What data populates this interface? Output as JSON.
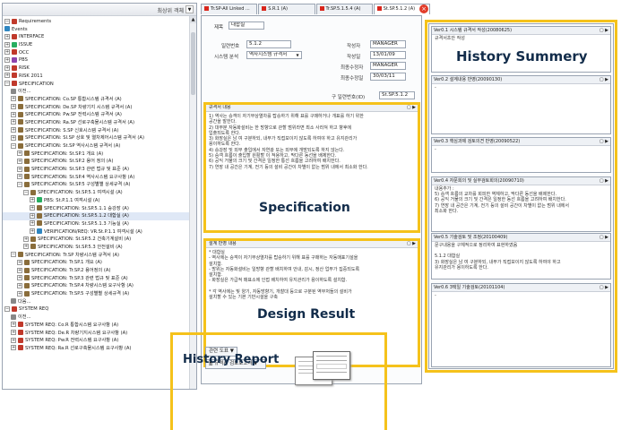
{
  "tree": {
    "sort_label": "최상위 객체",
    "rows": [
      {
        "text": "Requirements",
        "color": "#c0392b",
        "indent": 0,
        "pm": "⊟"
      },
      {
        "text": "Events",
        "color": "#2e86c1",
        "indent": 0,
        "pm": ""
      },
      {
        "text": "INTERFACE",
        "color": "#c0392b",
        "indent": 0,
        "pm": "⊞"
      },
      {
        "text": "ISSUE",
        "color": "#27ae60",
        "indent": 0,
        "pm": "⊞"
      },
      {
        "text": "OCC",
        "color": "#c0392b",
        "indent": 0,
        "pm": "⊞"
      },
      {
        "text": "PBS",
        "color": "#8e44ad",
        "indent": 0,
        "pm": "⊞"
      },
      {
        "text": "RISK",
        "color": "#c0392b",
        "indent": 0,
        "pm": "⊞"
      },
      {
        "text": "RISK 2011",
        "color": "#c0392b",
        "indent": 0,
        "pm": "⊞"
      },
      {
        "text": "SPECIFICATION",
        "color": "#c0392b",
        "indent": 0,
        "pm": "⊟"
      },
      {
        "text": "이전...",
        "color": "#888888",
        "indent": 1,
        "pm": ""
      },
      {
        "text": "SPECIFICATION: Co.SP 통합시스템 규격서 (A)",
        "color": "#8a6d3b",
        "indent": 1,
        "pm": "⊞"
      },
      {
        "text": "SPECIFICATION: De.SP 차량기지 시스템 규격서 (A)",
        "color": "#8a6d3b",
        "indent": 1,
        "pm": "⊞"
      },
      {
        "text": "SPECIFICATION: Pw.SP 전력시스템 규격서 (A)",
        "color": "#8a6d3b",
        "indent": 1,
        "pm": "⊞"
      },
      {
        "text": "SPECIFICATION: Ra.SP 선로구축물시스템 규격서 (A)",
        "color": "#8a6d3b",
        "indent": 1,
        "pm": "⊞"
      },
      {
        "text": "SPECIFICATION: S.SP 신호시스템 규격서 (A)",
        "color": "#8a6d3b",
        "indent": 1,
        "pm": "⊞"
      },
      {
        "text": "SPECIFICATION: SI.SP 상호 및 열차제어시스템 규격서 (A)",
        "color": "#8a6d3b",
        "indent": 1,
        "pm": "⊞"
      },
      {
        "text": "SPECIFICATION: St.SP 역사시스템 규격서 (A)",
        "color": "#8a6d3b",
        "indent": 1,
        "pm": "⊟"
      },
      {
        "text": "SPECIFICATION: St.SP.1 개요 (A)",
        "color": "#8a6d3b",
        "indent": 2,
        "pm": "⊞"
      },
      {
        "text": "SPECIFICATION: St.SP.2 용어 정의 (A)",
        "color": "#8a6d3b",
        "indent": 2,
        "pm": "⊞"
      },
      {
        "text": "SPECIFICATION: St.SP.3 관련 법규 및 표준 (A)",
        "color": "#8a6d3b",
        "indent": 2,
        "pm": "⊞"
      },
      {
        "text": "SPECIFICATION: St.SP.4 역사시스템 요구사항 (A)",
        "color": "#8a6d3b",
        "indent": 2,
        "pm": "⊞"
      },
      {
        "text": "SPECIFICATION: St.SP.5 구성별별 상세규격 (A)",
        "color": "#8a6d3b",
        "indent": 2,
        "pm": "⊟"
      },
      {
        "text": "SPECIFICATION: St.SP.5.1 여객시설 (A)",
        "color": "#8a6d3b",
        "indent": 3,
        "pm": "⊟"
      },
      {
        "text": "PBS: St.P.1.1 여객시설 (A)",
        "color": "#27ae60",
        "indent": 4,
        "pm": "⊞"
      },
      {
        "text": "SPECIFICATION: St.SP.5.1.1 승강장 (A)",
        "color": "#8a6d3b",
        "indent": 4,
        "pm": "⊞"
      },
      {
        "text": "SPECIFICATION: St.SP.5.1.2 대합실 (A)",
        "color": "#8a6d3b",
        "indent": 4,
        "pm": "⊞",
        "selected": true
      },
      {
        "text": "SPECIFICATION: St.SP.5.1.3 기능실 (A)",
        "color": "#8a6d3b",
        "indent": 4,
        "pm": "⊞"
      },
      {
        "text": "VERIFICATION/REQ: VR.St.P.1.1 여객시설 (A)",
        "color": "#2e86c1",
        "indent": 4,
        "pm": "⊞"
      },
      {
        "text": "SPECIFICATION: St.SP.5.2 건축기계설비 (A)",
        "color": "#8a6d3b",
        "indent": 3,
        "pm": "⊞"
      },
      {
        "text": "SPECIFICATION: St.SP.5.3 안전설비 (A)",
        "color": "#8a6d3b",
        "indent": 3,
        "pm": "⊞"
      },
      {
        "text": "SPECIFICATION: Tr.SP 차량시스템 규격서 (A)",
        "color": "#8a6d3b",
        "indent": 1,
        "pm": "⊟"
      },
      {
        "text": "SPECIFICATION: Tr.SP.1 개요 (A)",
        "color": "#8a6d3b",
        "indent": 2,
        "pm": "⊞"
      },
      {
        "text": "SPECIFICATION: Tr.SP.2 용어정의 (A)",
        "color": "#8a6d3b",
        "indent": 2,
        "pm": "⊞"
      },
      {
        "text": "SPECIFICATION: Tr.SP.3 관련 법규 및 표준 (A)",
        "color": "#8a6d3b",
        "indent": 2,
        "pm": "⊞"
      },
      {
        "text": "SPECIFICATION: Tr.SP.4 차량시스템 요구사항 (A)",
        "color": "#8a6d3b",
        "indent": 2,
        "pm": "⊞"
      },
      {
        "text": "SPECIFICATION: Tr.SP.5 구성별별 상세규격 (A)",
        "color": "#8a6d3b",
        "indent": 2,
        "pm": "⊞"
      },
      {
        "text": "다음...",
        "color": "#888888",
        "indent": 1,
        "pm": ""
      },
      {
        "text": "SYSTEM REQ",
        "color": "#c0392b",
        "indent": 0,
        "pm": "⊟"
      },
      {
        "text": "이전...",
        "color": "#888888",
        "indent": 1,
        "pm": ""
      },
      {
        "text": "SYSTEM REQ: Co.R 통합시스템 요구사항 (A)",
        "color": "#c0392b",
        "indent": 1,
        "pm": "⊞"
      },
      {
        "text": "SYSTEM REQ: De.R 차량기지시스템 요구사항 (A)",
        "color": "#c0392b",
        "indent": 1,
        "pm": "⊞"
      },
      {
        "text": "SYSTEM REQ: Pw.R 전력시스템 요구사항 (A)",
        "color": "#c0392b",
        "indent": 1,
        "pm": "⊞"
      },
      {
        "text": "SYSTEM REQ: Ra.R 선로구축물시스템 요구사항 (A)",
        "color": "#c0392b",
        "indent": 1,
        "pm": "⊞"
      }
    ]
  },
  "tabs": [
    {
      "label": "Tr.SP-All Linked ...",
      "active": false
    },
    {
      "label": "S.R.1 (A)",
      "active": false
    },
    {
      "label": "Tr.SP.5.1.5.4 (A)",
      "active": false
    },
    {
      "label": "St.SP.5.1.2 (A)",
      "active": true
    }
  ],
  "form": {
    "title_label": "제목",
    "title_value": "대합실",
    "id_label": "일련번호",
    "id_value": "5.1.2",
    "type_label": "시스템 분석",
    "type_value": "역사시스템 규격서",
    "author_label": "작성자",
    "author_value": "MANAGER",
    "created_label": "작성일",
    "created_value": "13/01/09",
    "modifier_label": "최종수정자",
    "modifier_value": "MANAGER",
    "modified_label": "최종수정일",
    "modified_value": "30/03/11",
    "old_id_label": "구 일련번호(ID)",
    "old_id_value": "St.SP.5.1.2"
  },
  "spec": {
    "header": "규격서 내용",
    "lines": [
      "1) 역사는 승객이 자기부상열차를 탑승하기 위해 표를 구매하거나 개표를 하기 위한",
      "공간을 말한다.",
      "2) 대부분 자동화설비는 한 방향으로 관할 범위라면 최소 사라져 하고 향후에",
      "입출되도록 한다.",
      "3) 화장실은 남 여 구분하되, 내부가 직접보이지 않도록 하여야 하고 유지관리가",
      "용이하도록 한다.",
      "4) 승강장 및 외부 출입에서 자연광 또는 외부에 개방되도록 하지 않는다.",
      "5) 승객 흐름이 출입할 원활할 이 적용하고, 막다른 동선을 배제한다.",
      "6) 공익 거물의 크기 및 간격은 일정한 통선 흐름을 고려하여 배치한다.",
      "7) 연장 내 공간은 기계, 전기 등의 설비 공간이 차별이 없는 범위 내에서 최소화 한다."
    ],
    "caption": "Specification"
  },
  "design": {
    "header": "설계 반영 내용",
    "lines": [
      "* 대합실",
      "- 역사에는 승객이 자기부상열차를 탑승하기 위해 표를 구매하는 자동매표기설을",
      "설치함.",
      "- 방위는 자동화설비는 일방향 관할 배치하여 안내, 감시, 정산 업무가 집중되도록",
      "설치함.",
      "- 화장실은 가급적 매표소에 인접 배치하여 유지관리가 용이하도록 설치함.",
      "",
      "* 각 역사에는 빛 양기, 자동방향기, 개찰대 등으로 구분된 역무처들의 설비가",
      "설치할 수 있는 기본 기반시설을 구축"
    ],
    "caption": "Design Result"
  },
  "history_panel": {
    "caption": "History Summery",
    "items": [
      {
        "title": "Ver0.1 시스템 규격서 작성(20080625)",
        "body": [
          "규격서초안 작성"
        ]
      },
      {
        "title": "Ver0.2 설계내용 반영(20090130)",
        "body": [
          "-"
        ]
      },
      {
        "title": "Ver0.3 핵심과제 검토의견 반영(20090522)",
        "body": [
          "-"
        ]
      },
      {
        "title": "Ver0.4 자문회의 및 실무검토회의(20090710)",
        "body": [
          "내용추가 :",
          "5) 승객 흐름의 교차를 회피한 역체하고, 막다른 동선을 배제한다.",
          "6) 공익 거물의 크기 및 간격은 일정한 동선 흐름을 고려하여 배치한다.",
          "7) 연장 내 공간은 기계, 전기 등의 설비 공간이 차별이 없는 범위 내에서",
          "최소화 한다."
        ]
      },
      {
        "title": "Ver0.5 기술검토 및 조정(20100409)",
        "body": [
          "문구내용을 구체적으로 정리하여 표현하였음",
          "",
          "5.1.2 대합실",
          "3) 화장실은 남 여 구분하되, 내부가 직접보이지 않도록 하여야 하고",
          "유지관리가 용이하도록 한다."
        ]
      },
      {
        "title": "Ver0.6 3택일 기술검토(20101104)",
        "body": [
          "-"
        ]
      }
    ]
  },
  "bottom": {
    "related_docs": "관련 도표",
    "report_button": "규격서 검토보고서",
    "caption": "History Report"
  },
  "colors": {
    "highlight": "#f5c21b",
    "caption_text": "#122c4a",
    "tab_close": "#e23c2a"
  }
}
